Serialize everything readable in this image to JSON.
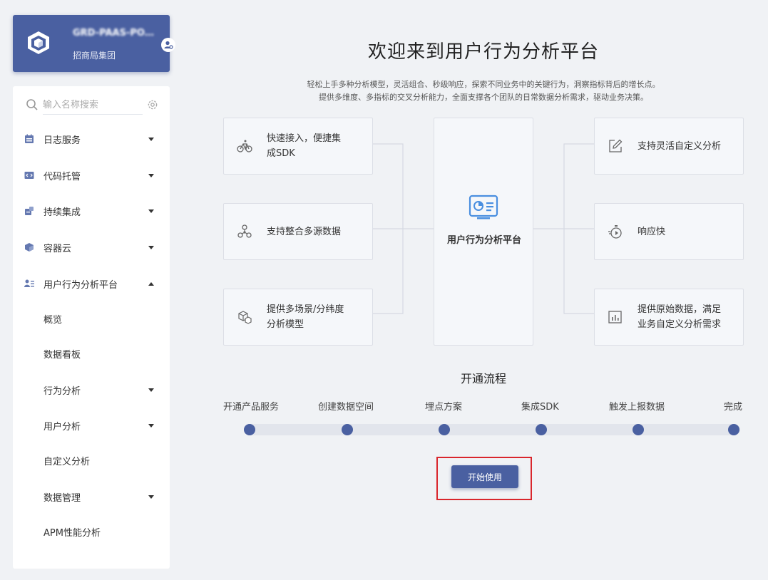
{
  "project": {
    "name": "GRD-PAAS-PO…",
    "org": "招商局集团"
  },
  "search": {
    "placeholder": "输入名称搜索"
  },
  "nav": {
    "items": [
      {
        "label": "日志服务",
        "expanded": false
      },
      {
        "label": "代码托管",
        "expanded": false
      },
      {
        "label": "持续集成",
        "expanded": false
      },
      {
        "label": "容器云",
        "expanded": false
      },
      {
        "label": "用户行为分析平台",
        "expanded": true
      }
    ],
    "sub": [
      {
        "label": "概览",
        "has_children": false
      },
      {
        "label": "数据看板",
        "has_children": false
      },
      {
        "label": "行为分析",
        "has_children": true
      },
      {
        "label": "用户分析",
        "has_children": true
      },
      {
        "label": "自定义分析",
        "has_children": false
      },
      {
        "label": "数据管理",
        "has_children": true
      },
      {
        "label": "APM性能分析",
        "has_children": false
      }
    ]
  },
  "main": {
    "title": "欢迎来到用户行为分析平台",
    "intro_line1": "轻松上手多种分析模型，灵活组合、秒级响应，探索不同业务中的关键行为，洞察指标背后的增长点。",
    "intro_line2": "提供多维度、多指标的交叉分析能力，全面支撑各个团队的日常数据分析需求，驱动业务决策。",
    "features_left": [
      {
        "line1": "快速接入，便捷集",
        "line2": "成SDK",
        "icon": "bicycle-icon"
      },
      {
        "line1": "支持整合多源数据",
        "line2": "",
        "icon": "nodes-icon"
      },
      {
        "line1": "提供多场景/分纬度",
        "line2": "分析模型",
        "icon": "cubes-icon"
      }
    ],
    "features_right": [
      {
        "line1": "支持灵活自定义分析",
        "line2": "",
        "icon": "edit-icon"
      },
      {
        "line1": "响应快",
        "line2": "",
        "icon": "stopwatch-icon"
      },
      {
        "line1": "提供原始数据，满足",
        "line2": "业务自定义分析需求",
        "icon": "bar-chart-icon"
      }
    ],
    "center_label": "用户行为分析平台"
  },
  "flow": {
    "title": "开通流程",
    "steps": [
      "开通产品服务",
      "创建数据空间",
      "埋点方案",
      "集成SDK",
      "触发上报数据",
      "完成"
    ]
  },
  "start_button": "开始使用",
  "colors": {
    "primary": "#4a60a1",
    "highlight": "#d9262c",
    "background": "#f0f2f5"
  }
}
